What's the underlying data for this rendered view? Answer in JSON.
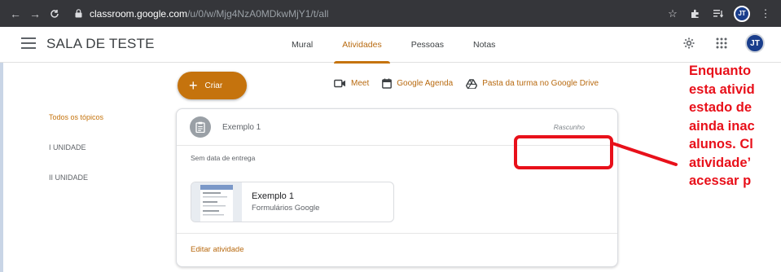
{
  "browser": {
    "url_host": "classroom.google.com",
    "url_path": "/u/0/w/Mjg4NzA0MDkwMjY1/t/all",
    "profile_initials": "JT"
  },
  "header": {
    "class_title": "SALA DE TESTE",
    "tabs": [
      {
        "label": "Mural",
        "active": false
      },
      {
        "label": "Atividades",
        "active": true
      },
      {
        "label": "Pessoas",
        "active": false
      },
      {
        "label": "Notas",
        "active": false
      }
    ],
    "avatar_initials": "JT"
  },
  "toolbar": {
    "create_label": "Criar",
    "links": {
      "meet": "Meet",
      "calendar": "Google Agenda",
      "drive": "Pasta da turma no Google Drive"
    }
  },
  "topics": [
    {
      "label": "Todos os tópicos",
      "active": true
    },
    {
      "label": "I UNIDADE",
      "active": false
    },
    {
      "label": "II UNIDADE",
      "active": false
    }
  ],
  "assignment": {
    "title": "Exemplo 1",
    "status": "Rascunho",
    "due": "Sem data de entrega",
    "attachment": {
      "name": "Exemplo 1",
      "type": "Formulários Google"
    },
    "edit_label": "Editar atividade"
  },
  "annotation": {
    "lines": [
      "Enquanto",
      "esta ativid",
      "estado de",
      "ainda inac",
      "alunos. Cl",
      "atividade’",
      "acessar p"
    ],
    "color": "#e8101a"
  },
  "colors": {
    "accent": "#c5730d",
    "chrome": "#35363a"
  }
}
